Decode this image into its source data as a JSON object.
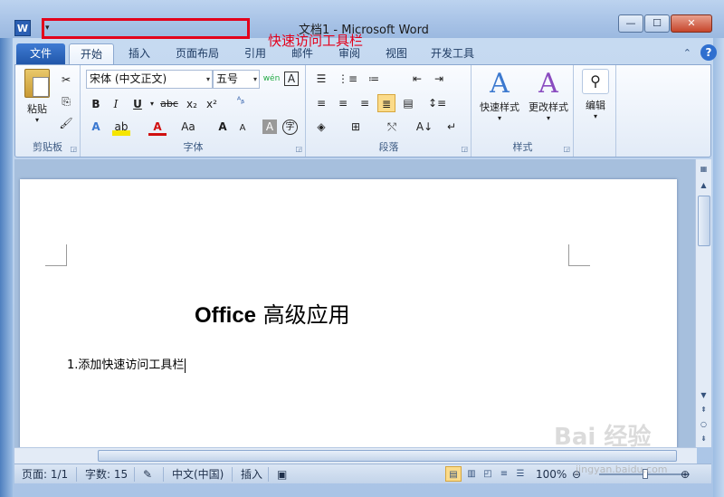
{
  "window": {
    "title": "文档1 - Microsoft Word",
    "app_icon": "W",
    "qat_dropdown": "▾",
    "annotation": "快速访问工具栏",
    "annotation_color": "#e3001b",
    "buttons": {
      "minimize": "—",
      "maximize": "☐",
      "close": "✕"
    }
  },
  "tabs": [
    "文件",
    "开始",
    "插入",
    "页面布局",
    "引用",
    "邮件",
    "审阅",
    "视图",
    "开发工具"
  ],
  "active_tab": "开始",
  "help": "?",
  "ribbon": {
    "clipboard": {
      "paste": "粘贴",
      "label": "剪贴板"
    },
    "font": {
      "font_name": "宋体 (中文正文)",
      "font_size": "五号",
      "label": "字体",
      "bold": "B",
      "italic": "I",
      "underline": "U",
      "strike": "abc",
      "subscript": "x₂",
      "superscript": "x²",
      "grow": "A",
      "shrink": "A",
      "case": "Aa"
    },
    "paragraph": {
      "label": "段落"
    },
    "styles": {
      "quick": "快速样式",
      "change": "更改样式",
      "label": "样式"
    },
    "editing": {
      "label": "编辑"
    }
  },
  "document": {
    "title_latin": "Office",
    "title_cjk": "高级应用",
    "line1": "1.添加快速访问工具栏"
  },
  "status": {
    "page": "页面: 1/1",
    "words": "字数: 15",
    "language": "中文(中国)",
    "mode": "插入",
    "zoom": "100%",
    "zoom_level": 1.0
  },
  "watermark": {
    "text": "Bai 经验",
    "sub": "jingyan.baidu.com"
  }
}
